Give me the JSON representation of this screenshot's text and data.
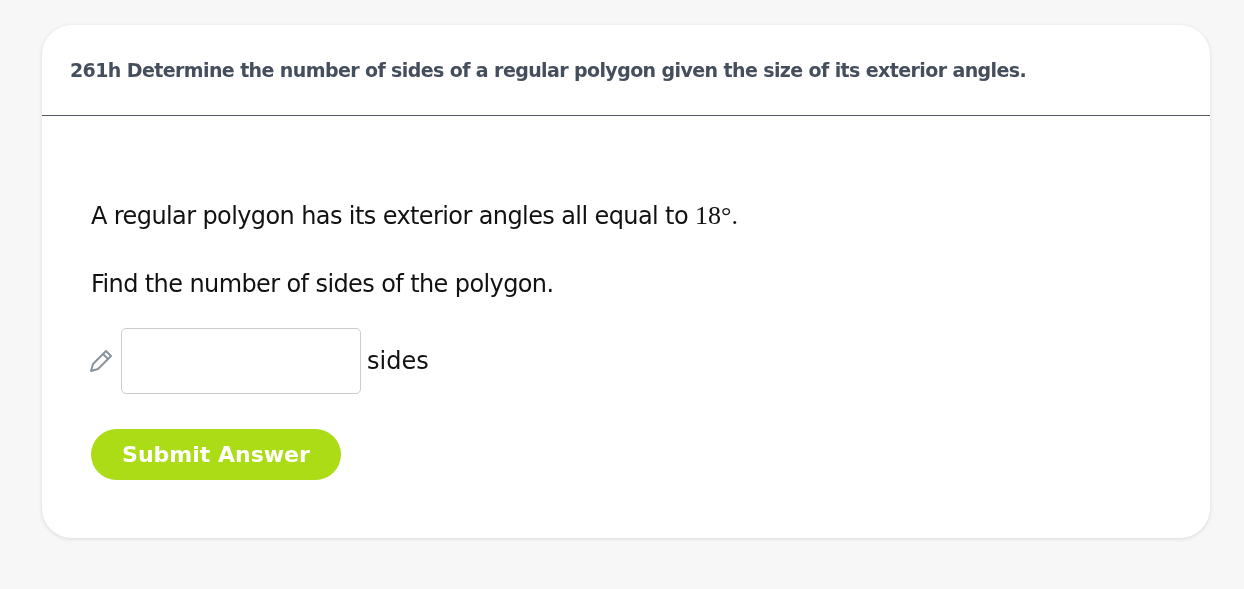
{
  "card": {
    "title": "261h Determine the number of sides of a regular polygon given the size of its exterior angles.",
    "question": {
      "text": "A regular polygon has its exterior angles all equal to",
      "math": "18°."
    },
    "instruction": "Find the number of sides of the polygon.",
    "answer": {
      "unit": "sides"
    },
    "submit": "Submit Answer"
  }
}
